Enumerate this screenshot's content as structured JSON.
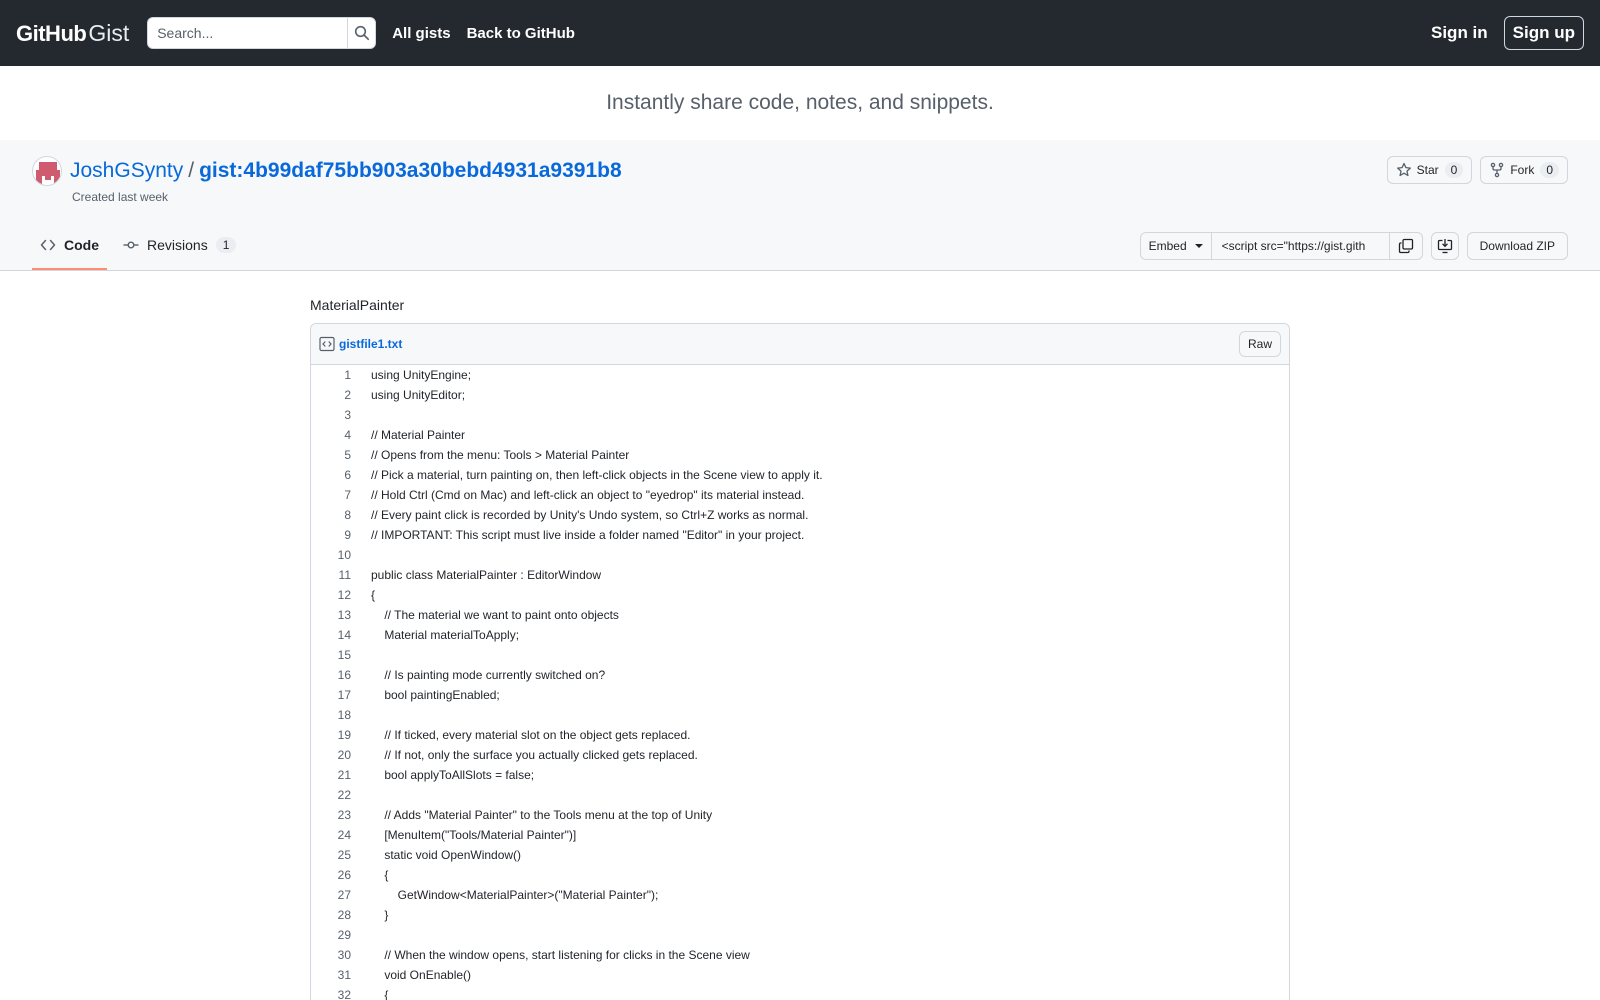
{
  "header": {
    "logo_github": "GitHub",
    "logo_gist": "Gist",
    "search_placeholder": "Search...",
    "nav": [
      "All gists",
      "Back to GitHub"
    ],
    "sign_in": "Sign in",
    "sign_up": "Sign up"
  },
  "tagline": "Instantly share code, notes, and snippets.",
  "gist": {
    "owner": "JoshGSynty",
    "separator": "/",
    "id": "gist:4b99daf75bb903a30bebd4931a9391b8",
    "created": "Created last week",
    "star_label": "Star",
    "star_count": "0",
    "fork_label": "Fork",
    "fork_count": "0"
  },
  "tabs": {
    "code": "Code",
    "revisions": "Revisions",
    "revisions_count": "1"
  },
  "embed": {
    "label": "Embed",
    "value": "<script src=\"https://gist.gith",
    "download": "Download ZIP"
  },
  "file": {
    "description": "MaterialPainter",
    "name": "gistfile1.txt",
    "raw": "Raw",
    "lines": [
      "using UnityEngine;",
      "using UnityEditor;",
      "",
      "// Material Painter",
      "// Opens from the menu: Tools > Material Painter",
      "// Pick a material, turn painting on, then left-click objects in the Scene view to apply it.",
      "// Hold Ctrl (Cmd on Mac) and left-click an object to \"eyedrop\" its material instead.",
      "// Every paint click is recorded by Unity's Undo system, so Ctrl+Z works as normal.",
      "// IMPORTANT: This script must live inside a folder named \"Editor\" in your project.",
      "",
      "public class MaterialPainter : EditorWindow",
      "{",
      "    // The material we want to paint onto objects",
      "    Material materialToApply;",
      "",
      "    // Is painting mode currently switched on?",
      "    bool paintingEnabled;",
      "",
      "    // If ticked, every material slot on the object gets replaced.",
      "    // If not, only the surface you actually clicked gets replaced.",
      "    bool applyToAllSlots = false;",
      "",
      "    // Adds \"Material Painter\" to the Tools menu at the top of Unity",
      "    [MenuItem(\"Tools/Material Painter\")]",
      "    static void OpenWindow()",
      "    {",
      "        GetWindow<MaterialPainter>(\"Material Painter\");",
      "    }",
      "",
      "    // When the window opens, start listening for clicks in the Scene view",
      "    void OnEnable()",
      "    {"
    ]
  },
  "colors": {
    "header_bg": "#24292f",
    "link": "#0969da",
    "tab_underline": "#fd8c73"
  }
}
